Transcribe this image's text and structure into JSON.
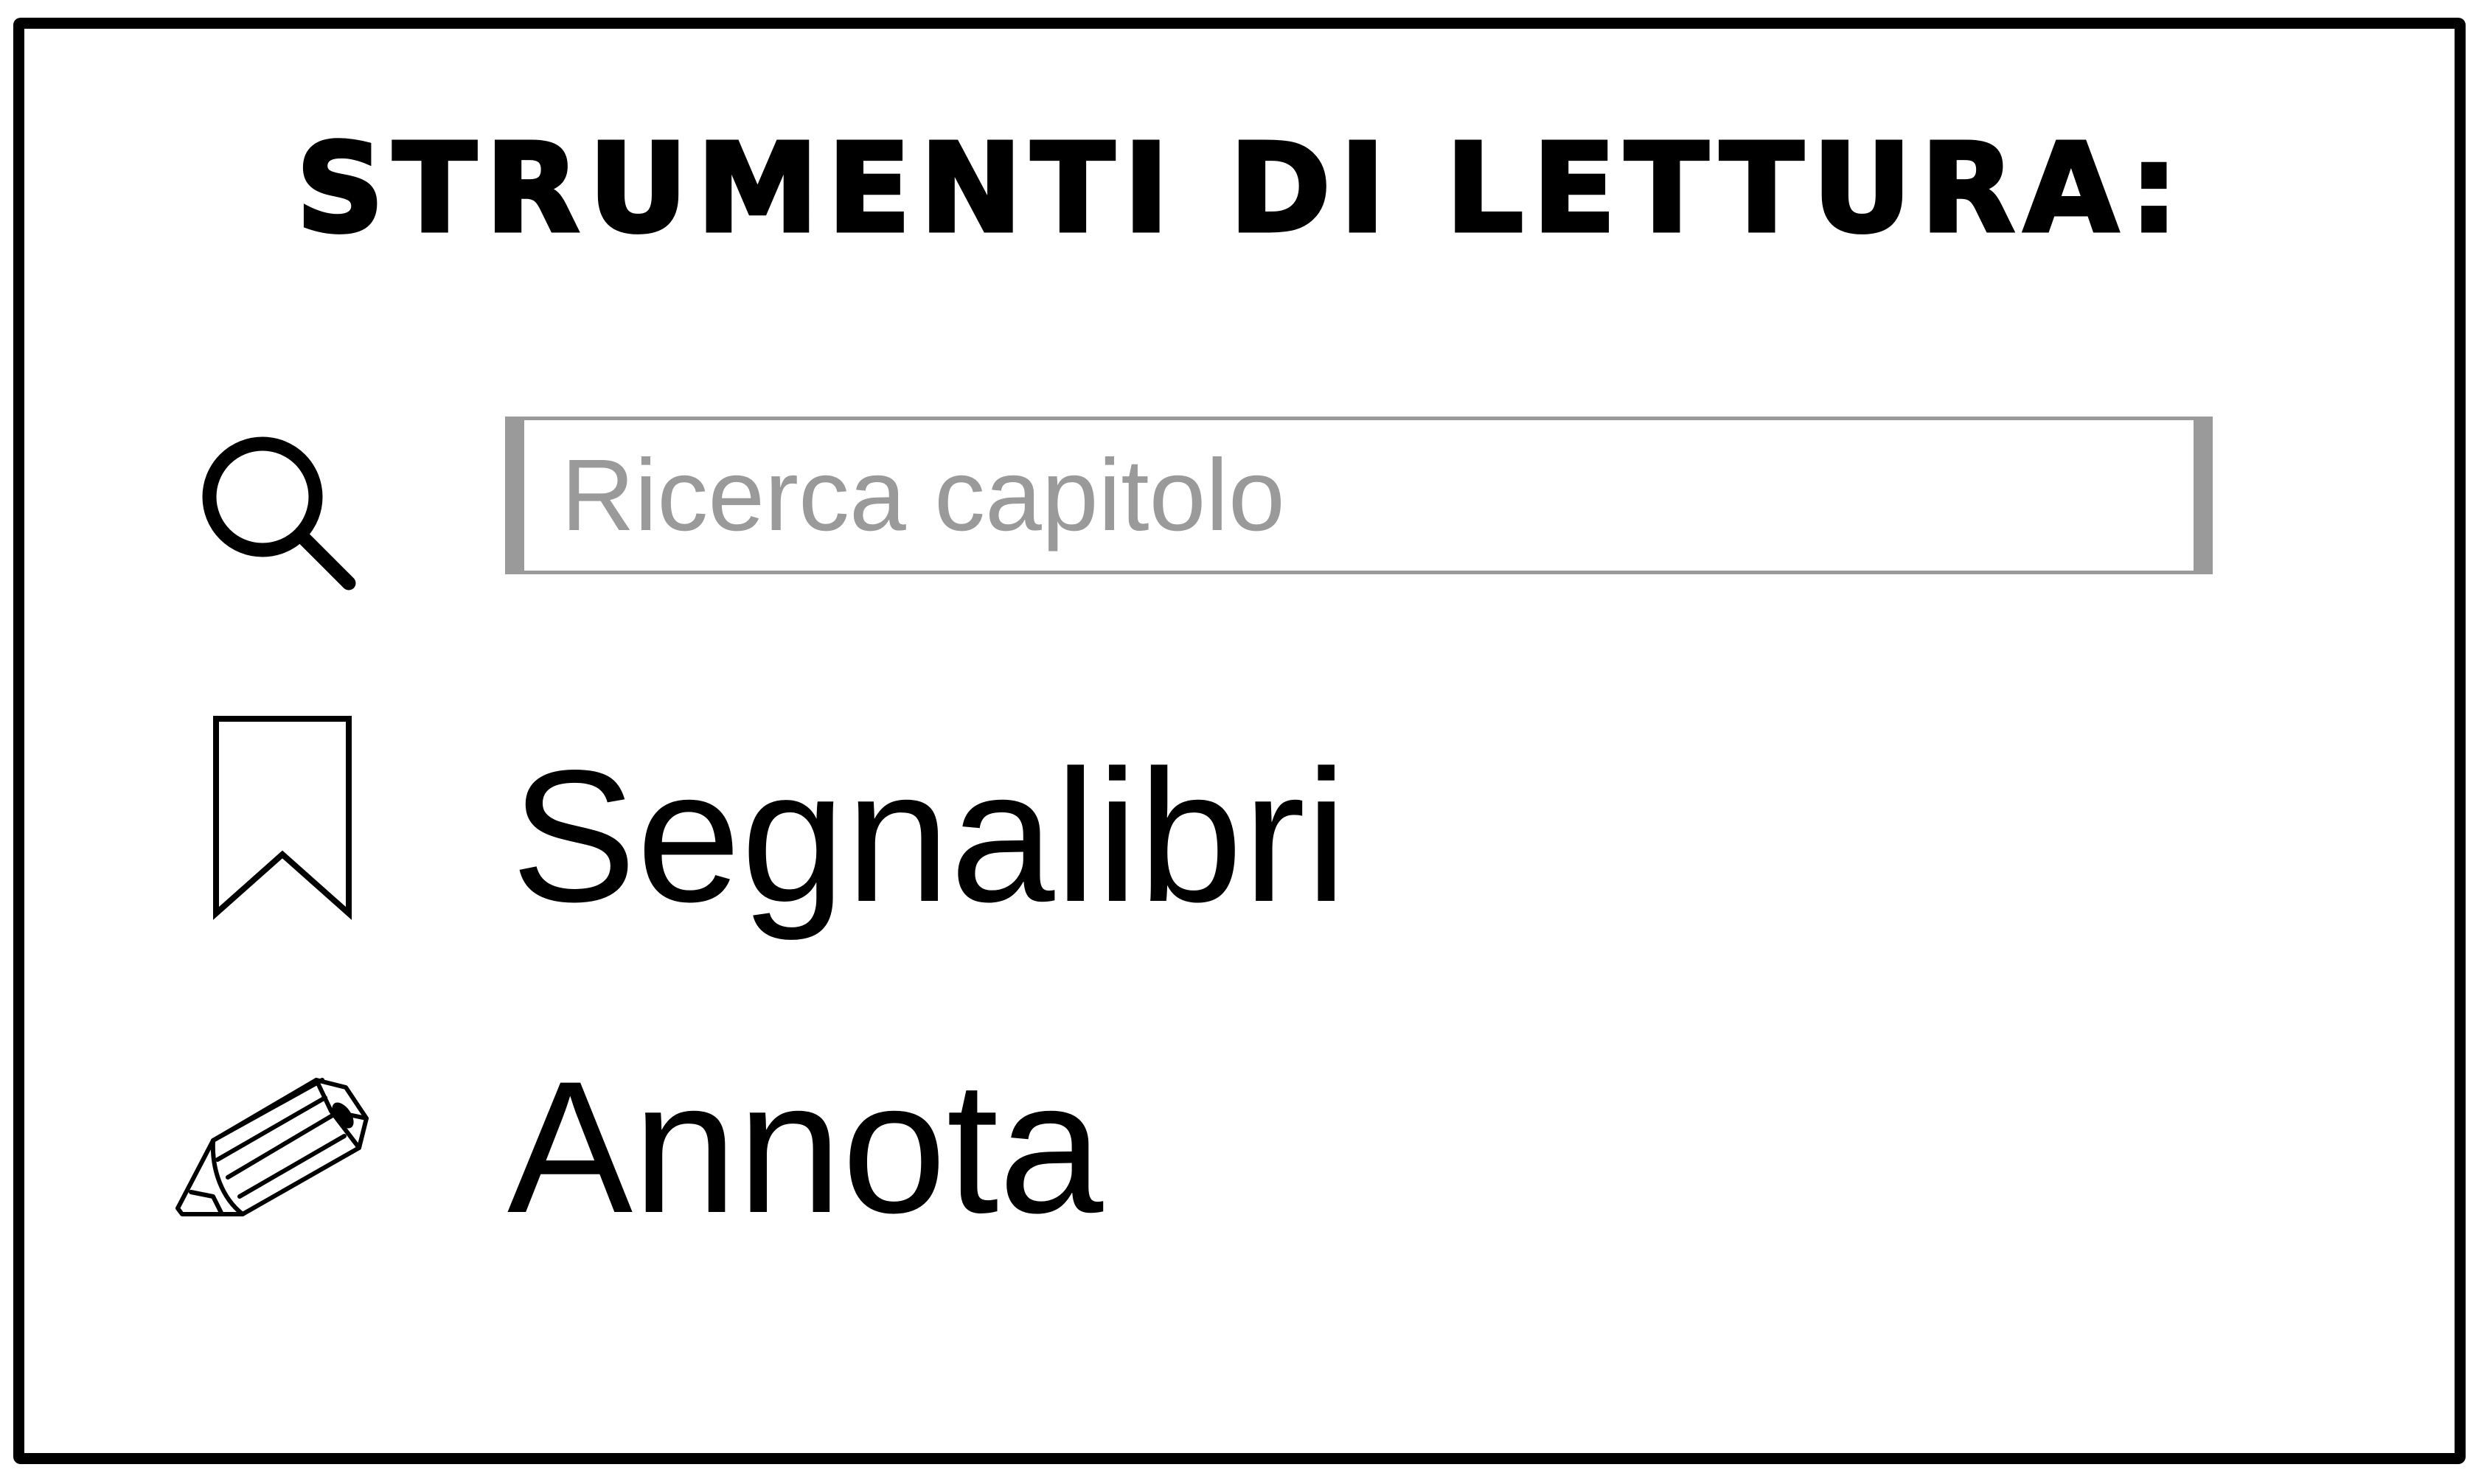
{
  "panel": {
    "title": "STRUMENTI DI LETTURA:"
  },
  "search": {
    "icon": "search-icon",
    "placeholder": "Ricerca capitolo",
    "value": ""
  },
  "menu": {
    "items": [
      {
        "icon": "bookmark-icon",
        "label": "Segnalibri"
      },
      {
        "icon": "pencil-icon",
        "label": "Annota"
      }
    ]
  },
  "colors": {
    "border": "#000000",
    "placeholder": "#9a9a9a",
    "field_border": "#9a9a9a",
    "background": "#ffffff"
  }
}
